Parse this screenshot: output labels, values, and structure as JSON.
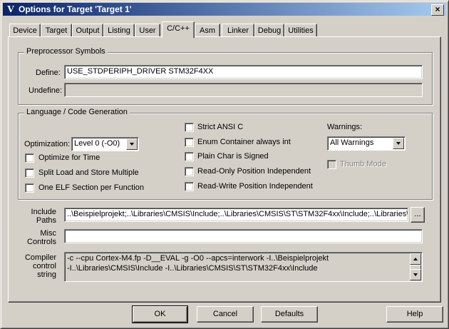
{
  "window": {
    "title": "Options for Target 'Target 1'",
    "icon": "keil-uvision-icon",
    "close_label": "×"
  },
  "tabs": [
    {
      "label": "Device"
    },
    {
      "label": "Target"
    },
    {
      "label": "Output"
    },
    {
      "label": "Listing"
    },
    {
      "label": "User"
    },
    {
      "label": "C/C++",
      "active": true
    },
    {
      "label": "Asm"
    },
    {
      "label": "Linker"
    },
    {
      "label": "Debug"
    },
    {
      "label": "Utilities"
    }
  ],
  "preprocessor": {
    "group_title": "Preprocessor Symbols",
    "define_label": "Define:",
    "define_value": "USE_STDPERIPH_DRIVER STM32F4XX",
    "undefine_label": "Undefine:",
    "undefine_value": ""
  },
  "language": {
    "group_title": "Language / Code Generation",
    "optimization_label": "Optimization:",
    "optimization_value": "Level 0 (-O0)",
    "options_left": [
      {
        "label": "Optimize for Time",
        "checked": false
      },
      {
        "label": "Split Load and Store Multiple",
        "checked": false
      },
      {
        "label": "One ELF Section per Function",
        "checked": false
      }
    ],
    "options_mid": [
      {
        "label": "Strict ANSI C",
        "checked": false
      },
      {
        "label": "Enum Container always int",
        "checked": false
      },
      {
        "label": "Plain Char is Signed",
        "checked": false
      },
      {
        "label": "Read-Only Position Independent",
        "checked": false
      },
      {
        "label": "Read-Write Position Independent",
        "checked": false
      }
    ],
    "warnings_label": "Warnings:",
    "warnings_value": "All Warnings",
    "thumb_mode_label": "Thumb Mode",
    "thumb_mode_checked": false
  },
  "include": {
    "label_line1": "Include",
    "label_line2": "Paths",
    "value": "..\\Beispielprojekt;..\\Libraries\\CMSIS\\Include;..\\Libraries\\CMSIS\\ST\\STM32F4xx\\Include;..\\Libraries\\",
    "browse_label": "..."
  },
  "misc": {
    "label_line1": "Misc",
    "label_line2": "Controls",
    "value": ""
  },
  "compiler": {
    "label_line1": "Compiler",
    "label_line2": "control",
    "label_line3": "string",
    "line1": "-c --cpu Cortex-M4.fp -D__EVAL -g -O0 --apcs=interwork -I..\\Beispielprojekt",
    "line2": "-I..\\Libraries\\CMSIS\\Include -I..\\Libraries\\CMSIS\\ST\\STM32F4xx\\Include"
  },
  "buttons": {
    "ok": "OK",
    "cancel": "Cancel",
    "defaults": "Defaults",
    "help": "Help"
  }
}
